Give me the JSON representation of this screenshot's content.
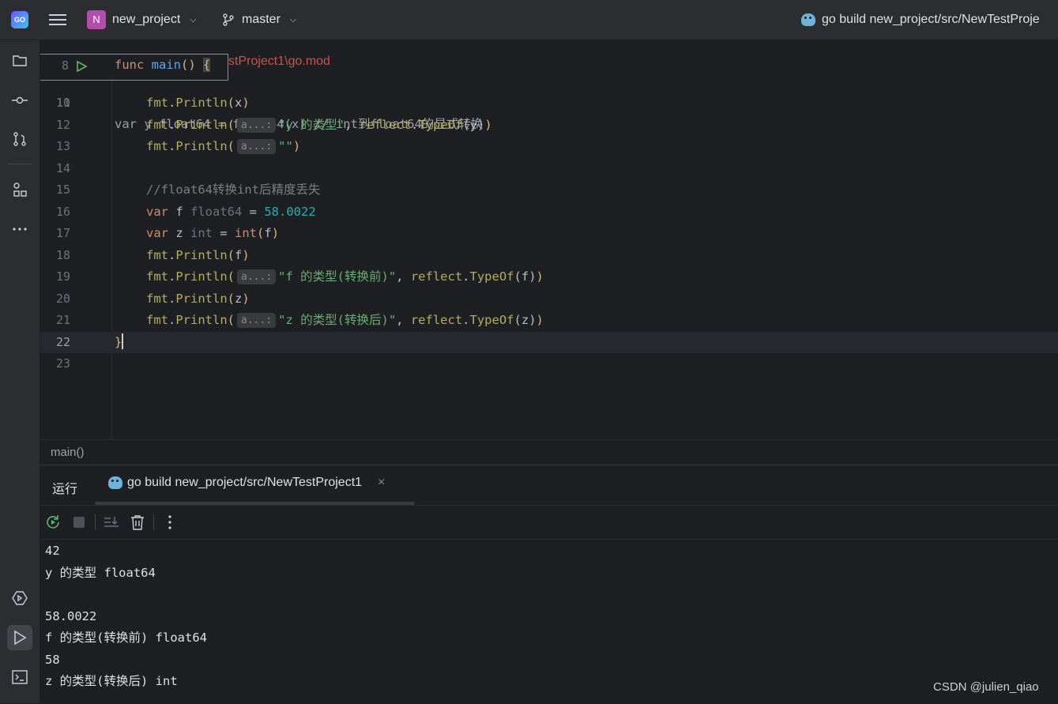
{
  "titlebar": {
    "project_initial": "N",
    "project_name": "new_project",
    "branch": "master",
    "run_config": "go build new_project/src/NewTestProje"
  },
  "tool_strip": {
    "top": [
      "folder-icon",
      "commit-icon",
      "pull-requests-icon",
      "structure-icon",
      "more-icon"
    ],
    "bottom": [
      "services-icon",
      "run-icon",
      "terminal-icon"
    ]
  },
  "editor": {
    "sticky": {
      "line_number": "8",
      "code": "func main() {",
      "behind_text": "stProject1\\go.mod"
    },
    "partial_line": {
      "line_number": "10",
      "code": "var y float64 = float64(x) // int到float64的显式转换"
    },
    "lines": [
      {
        "num": "11",
        "parts": [
          [
            "call",
            "fmt"
          ],
          [
            "p",
            "."
          ],
          [
            "call",
            "Println"
          ],
          [
            "b1",
            "("
          ],
          [
            "p",
            "x"
          ],
          [
            "b1",
            ")"
          ]
        ]
      },
      {
        "num": "12",
        "parts": [
          [
            "call",
            "fmt"
          ],
          [
            "p",
            "."
          ],
          [
            "call",
            "Println"
          ],
          [
            "b1",
            "("
          ],
          [
            "hint",
            "a...:"
          ],
          [
            "s",
            "\"y 的类型\""
          ],
          [
            "p",
            ", "
          ],
          [
            "call",
            "reflect"
          ],
          [
            "p",
            "."
          ],
          [
            "call",
            "TypeOf"
          ],
          [
            "b2",
            "("
          ],
          [
            "p",
            "y"
          ],
          [
            "b2",
            ")"
          ],
          [
            "b1",
            ")"
          ]
        ]
      },
      {
        "num": "13",
        "parts": [
          [
            "call",
            "fmt"
          ],
          [
            "p",
            "."
          ],
          [
            "call",
            "Println"
          ],
          [
            "b1",
            "("
          ],
          [
            "hint",
            "a...:"
          ],
          [
            "s",
            "\"\""
          ],
          [
            "b1",
            ")"
          ]
        ]
      },
      {
        "num": "14",
        "parts": []
      },
      {
        "num": "15",
        "parts": [
          [
            "c",
            "//float64转换int后精度丢失"
          ]
        ]
      },
      {
        "num": "16",
        "parts": [
          [
            "k",
            "var "
          ],
          [
            "p",
            "f "
          ],
          [
            "t",
            "float64"
          ],
          [
            "p",
            " = "
          ],
          [
            "n",
            "58.0022"
          ]
        ]
      },
      {
        "num": "17",
        "parts": [
          [
            "k",
            "var "
          ],
          [
            "p",
            "z "
          ],
          [
            "t",
            "int"
          ],
          [
            "p",
            " = "
          ],
          [
            "k",
            "int"
          ],
          [
            "b1",
            "("
          ],
          [
            "p",
            "f"
          ],
          [
            "b1",
            ")"
          ]
        ]
      },
      {
        "num": "18",
        "parts": [
          [
            "call",
            "fmt"
          ],
          [
            "p",
            "."
          ],
          [
            "call",
            "Println"
          ],
          [
            "b1",
            "("
          ],
          [
            "p",
            "f"
          ],
          [
            "b1",
            ")"
          ]
        ]
      },
      {
        "num": "19",
        "parts": [
          [
            "call",
            "fmt"
          ],
          [
            "p",
            "."
          ],
          [
            "call",
            "Println"
          ],
          [
            "b1",
            "("
          ],
          [
            "hint",
            "a...:"
          ],
          [
            "s",
            "\"f 的类型(转换前)\""
          ],
          [
            "p",
            ", "
          ],
          [
            "call",
            "reflect"
          ],
          [
            "p",
            "."
          ],
          [
            "call",
            "TypeOf"
          ],
          [
            "b2",
            "("
          ],
          [
            "p",
            "f"
          ],
          [
            "b2",
            ")"
          ],
          [
            "b1",
            ")"
          ]
        ]
      },
      {
        "num": "20",
        "parts": [
          [
            "call",
            "fmt"
          ],
          [
            "p",
            "."
          ],
          [
            "call",
            "Println"
          ],
          [
            "b1",
            "("
          ],
          [
            "p",
            "z"
          ],
          [
            "b1",
            ")"
          ]
        ]
      },
      {
        "num": "21",
        "parts": [
          [
            "call",
            "fmt"
          ],
          [
            "p",
            "."
          ],
          [
            "call",
            "Println"
          ],
          [
            "b1",
            "("
          ],
          [
            "hint",
            "a...:"
          ],
          [
            "s",
            "\"z 的类型(转换后)\""
          ],
          [
            "p",
            ", "
          ],
          [
            "call",
            "reflect"
          ],
          [
            "p",
            "."
          ],
          [
            "call",
            "TypeOf"
          ],
          [
            "b2",
            "("
          ],
          [
            "p",
            "z"
          ],
          [
            "b2",
            ")"
          ],
          [
            "b1",
            ")"
          ]
        ]
      },
      {
        "num": "22",
        "current": true,
        "parts": [
          [
            "pkg",
            "}"
          ],
          [
            "caret",
            ""
          ]
        ]
      },
      {
        "num": "23",
        "parts": []
      }
    ]
  },
  "breadcrumb": "main()",
  "run_window": {
    "title": "运行",
    "tab_label": "go build new_project/src/NewTestProject1",
    "toolbar": [
      "rerun-icon",
      "stop-icon",
      "scroll-to-end-icon",
      "clear-icon",
      "more-icon"
    ],
    "output": [
      "42",
      "y 的类型 float64",
      "",
      "58.0022",
      "f 的类型(转换前) float64",
      "58",
      "z 的类型(转换后) int"
    ]
  },
  "watermark": "CSDN @julien_qiao",
  "colors": {
    "background": "#1e1f22",
    "panel": "#2b2d30",
    "keyword": "#cf8e6d",
    "function": "#56a8f5",
    "string": "#6aab73",
    "number": "#2aacb8",
    "error_text": "#c75450"
  }
}
